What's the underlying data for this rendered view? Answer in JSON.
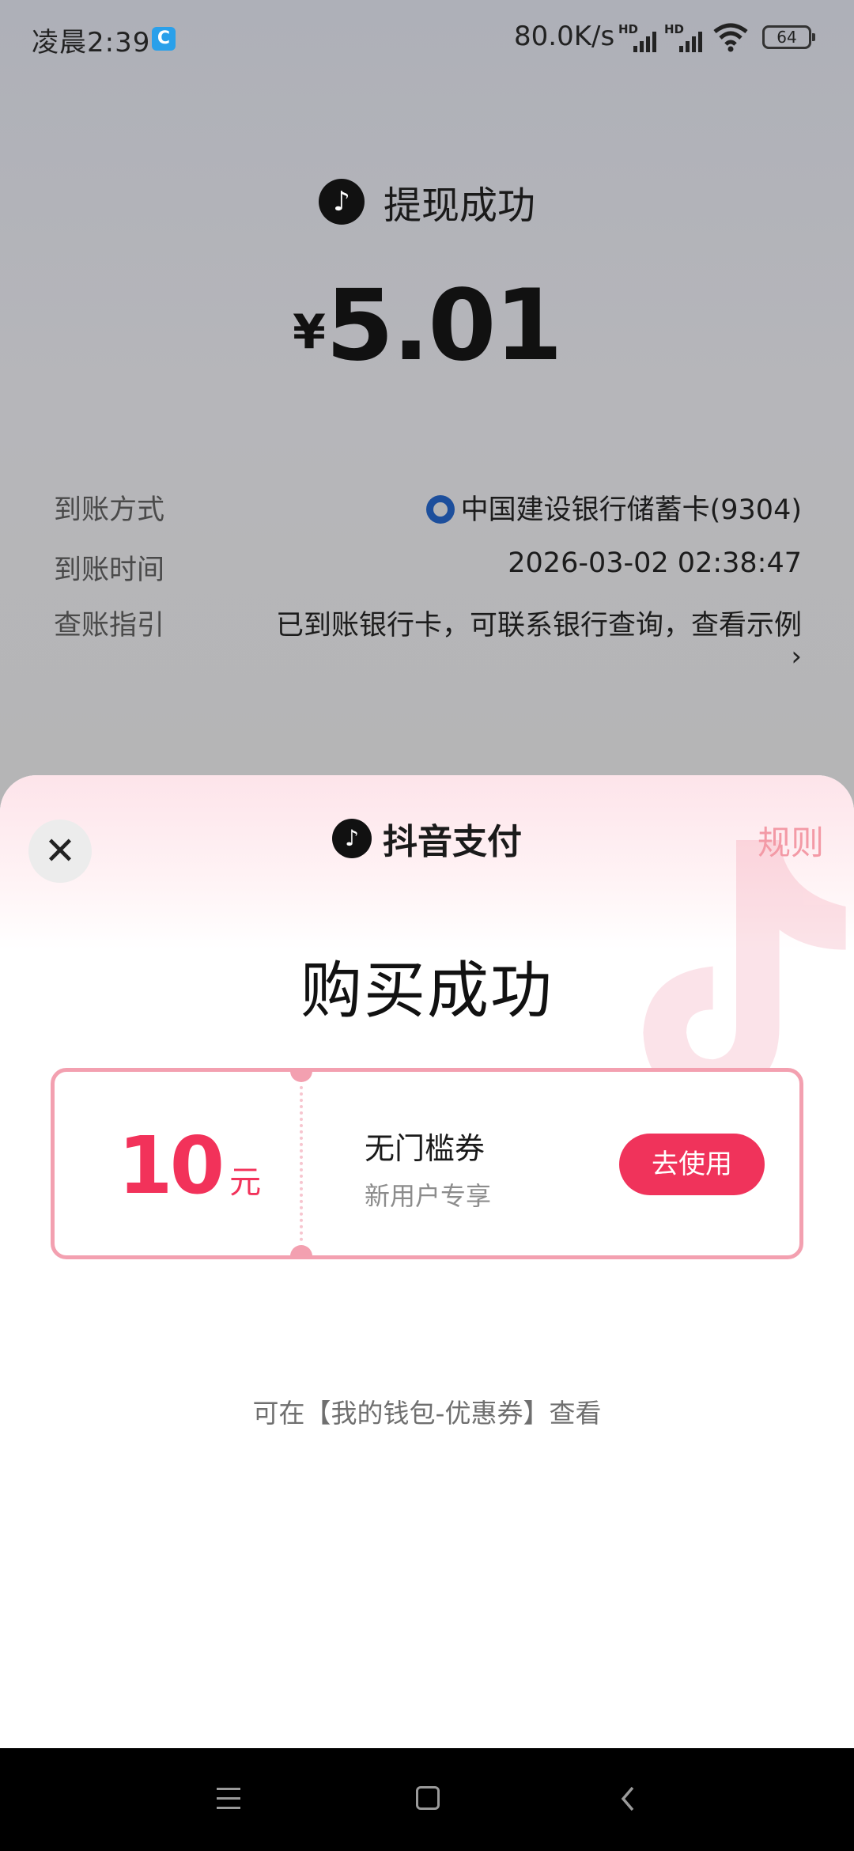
{
  "status_bar": {
    "time": "凌晨2:39",
    "app_icon_glyph": "C",
    "net_speed": "80.0K/s",
    "signal1_label": "HD",
    "signal2_label": "HD",
    "battery": "64"
  },
  "withdraw": {
    "logo_glyph": "♪",
    "title": "提现成功",
    "currency": "¥",
    "amount": "5.01",
    "rows": [
      {
        "key": "到账方式",
        "value": "中国建设银行储蓄卡(9304)"
      },
      {
        "key": "到账时间",
        "value": "2026-03-02 02:38:47"
      },
      {
        "key": "查账指引",
        "value": "已到账银行卡，可联系银行查询，查看示例"
      }
    ],
    "chevron": "›"
  },
  "sheet": {
    "close_glyph": "✕",
    "brand_logo_glyph": "♪",
    "brand_name": "抖音支付",
    "rules_label": "规则",
    "title": "购买成功",
    "coupon": {
      "value": "10",
      "unit": "元",
      "name": "无门槛券",
      "desc": "新用户专享",
      "button_label": "去使用"
    },
    "wallet_hint": "可在【我的钱包-优惠券】查看"
  },
  "colors": {
    "accent": "#f0335b",
    "coupon_border": "#f3a0b0",
    "rules": "#f39aa6"
  }
}
